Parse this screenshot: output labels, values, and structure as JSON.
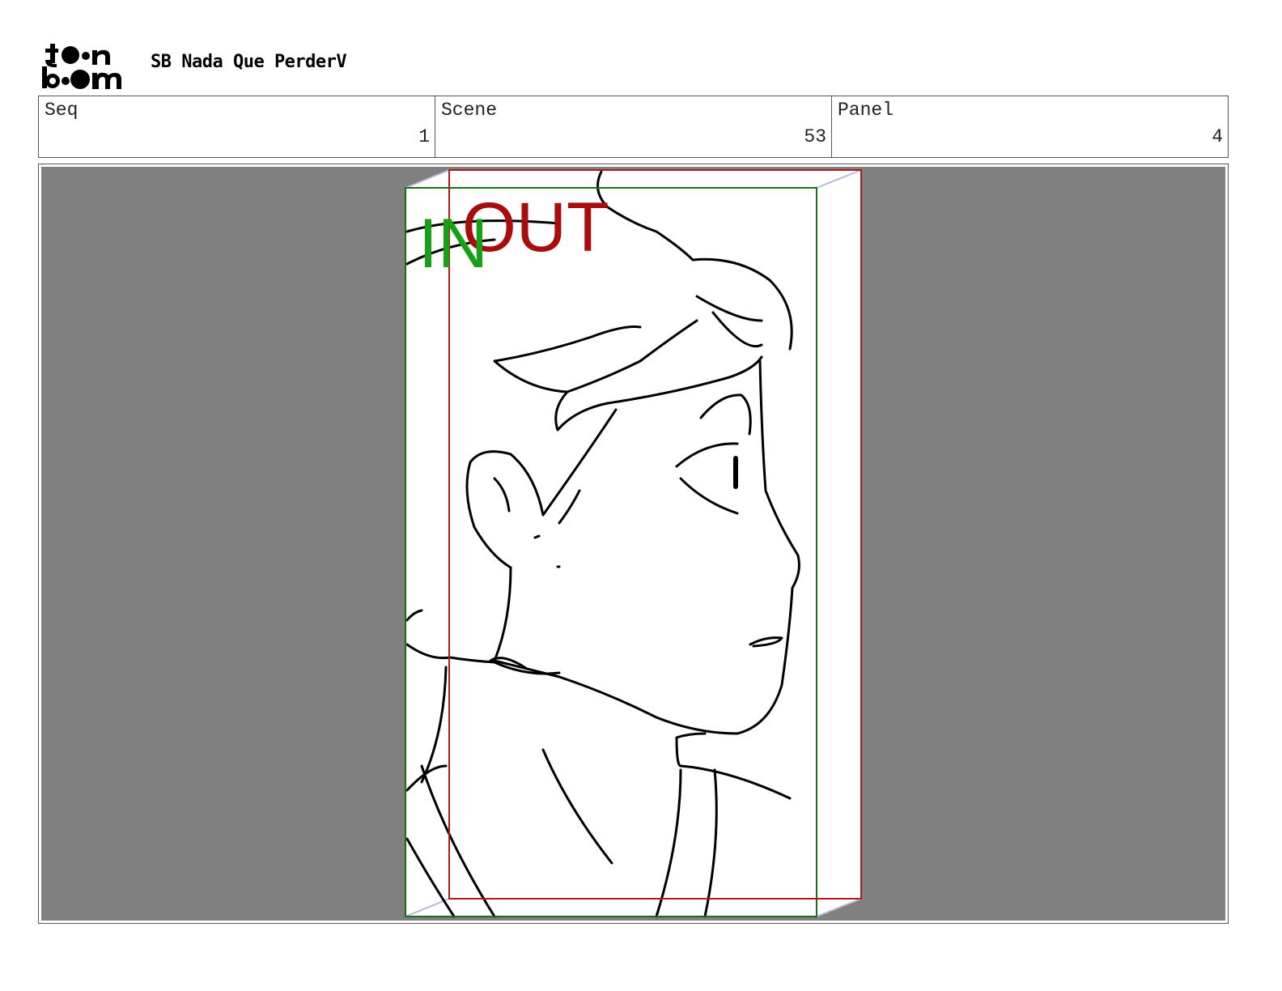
{
  "header": {
    "logo_text": "toon boom",
    "project_title": "SB Nada Que PerderV"
  },
  "info": {
    "seq_label": "Seq",
    "seq_value": "1",
    "scene_label": "Scene",
    "scene_value": "53",
    "panel_label": "Panel",
    "panel_value": "4"
  },
  "camera": {
    "in_label": "IN",
    "out_label": "OUT",
    "in_color": "#1a8f1a",
    "out_color": "#a01010"
  },
  "colors": {
    "stage_background": "#808080",
    "frame_fill": "#ffffff",
    "in_frame": "#1a6e1a",
    "out_frame": "#b01c1c",
    "in_label": "#16a016",
    "out_label": "#a80c0c"
  }
}
